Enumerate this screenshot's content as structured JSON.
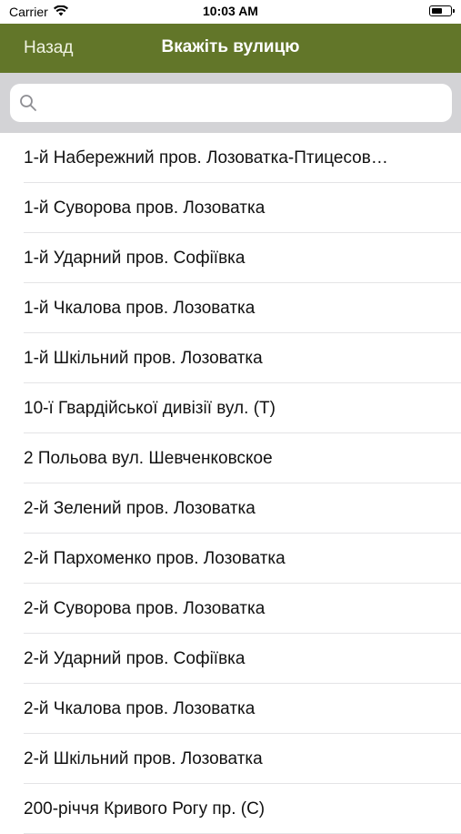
{
  "status_bar": {
    "carrier": "Carrier",
    "time": "10:03 AM",
    "wifi_icon": "wifi-icon",
    "battery_icon": "battery-icon"
  },
  "nav": {
    "back_label": "Назад",
    "title": "Вкажіть вулицю",
    "bar_color": "#627629"
  },
  "search": {
    "placeholder": "",
    "value": "",
    "icon": "search-icon"
  },
  "streets": [
    "1-й Набережний пров. Лозоватка-Птицесов…",
    "1-й Суворова пров. Лозоватка",
    "1-й Ударний пров. Софіївка",
    "1-й Чкалова пров. Лозоватка",
    "1-й Шкільний пров. Лозоватка",
    "10-ї Гвардійської дивізії вул. (Т)",
    "2 Польова вул. Шевченковское",
    "2-й Зелений пров. Лозоватка",
    "2-й Пархоменко пров. Лозоватка",
    "2-й Суворова пров. Лозоватка",
    "2-й Ударний пров. Софіївка",
    "2-й Чкалова пров. Лозоватка",
    "2-й Шкільний пров. Лозоватка",
    "200-річчя Кривого Рогу пр. (С)"
  ]
}
